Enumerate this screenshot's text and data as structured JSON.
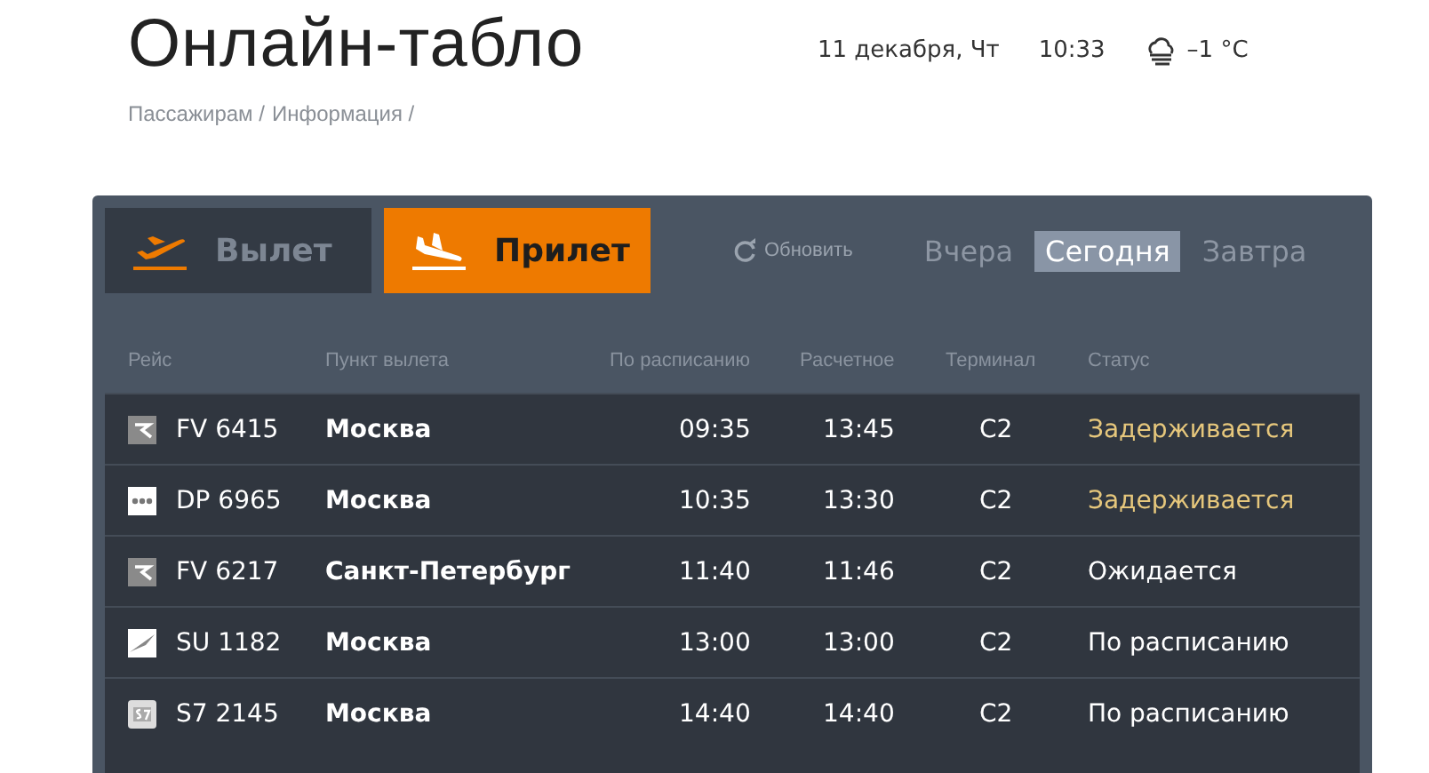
{
  "header": {
    "title": "Онлайн-табло",
    "date": "11 декабря, Чт",
    "time": "10:33",
    "temperature": "–1 °C"
  },
  "breadcrumbs": [
    "Пассажирам /",
    "Информация /"
  ],
  "direction_tabs": [
    {
      "label": "Вылет",
      "kind": "departure",
      "selected": false
    },
    {
      "label": "Прилет",
      "kind": "arrival",
      "selected": true
    }
  ],
  "refresh_button": "Обновить",
  "day_tabs": [
    {
      "label": "Вчера",
      "selected": false
    },
    {
      "label": "Сегодня",
      "selected": true
    },
    {
      "label": "Завтра",
      "selected": false
    }
  ],
  "table": {
    "columns": [
      "Рейс",
      "Пункт вылета",
      "По расписанию",
      "Расчетное",
      "Терминал",
      "Статус"
    ],
    "rows": [
      {
        "kind": "r-mark",
        "flight": "FV 6415",
        "origin": "Москва",
        "scheduled": "09:35",
        "estimated": "13:45",
        "terminal": "C2",
        "status": "Задерживается",
        "color": "#e6c77c"
      },
      {
        "kind": "dots",
        "flight": "DP 6965",
        "origin": "Москва",
        "scheduled": "10:35",
        "estimated": "13:30",
        "terminal": "C2",
        "status": "Задерживается",
        "color": "#e6c77c"
      },
      {
        "kind": "r-mark",
        "flight": "FV 6217",
        "origin": "Санкт-Петербург",
        "scheduled": "11:40",
        "estimated": "11:46",
        "terminal": "C2",
        "status": "Ожидается",
        "color": "#ffffff"
      },
      {
        "kind": "wing",
        "flight": "SU 1182",
        "origin": "Москва",
        "scheduled": "13:00",
        "estimated": "13:00",
        "terminal": "C2",
        "status": "По расписанию",
        "color": "#ffffff"
      },
      {
        "kind": "s7",
        "flight": "S7 2145",
        "origin": "Москва",
        "scheduled": "14:40",
        "estimated": "14:40",
        "terminal": "C2",
        "status": "По расписанию",
        "color": "#ffffff"
      }
    ]
  }
}
